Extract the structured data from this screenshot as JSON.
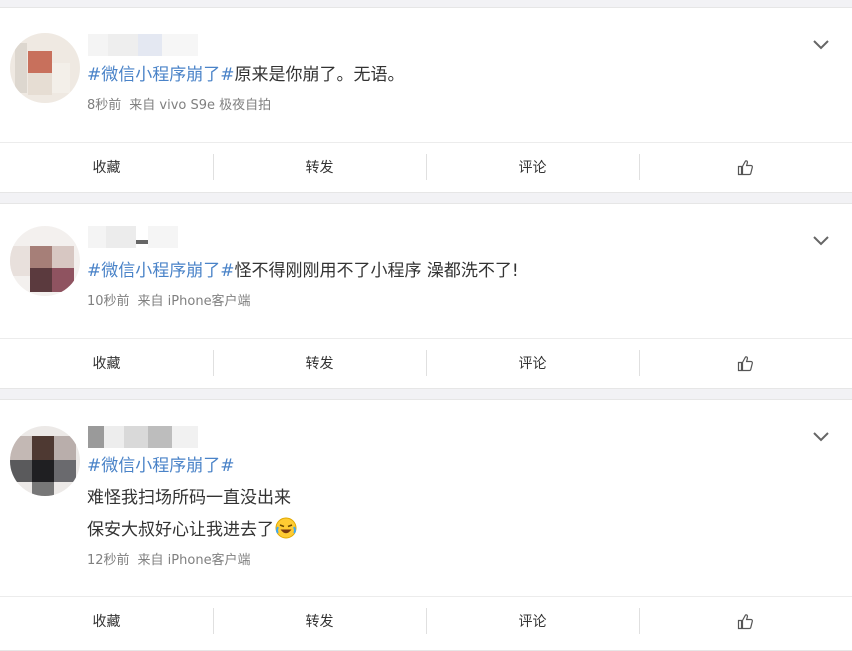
{
  "posts": [
    {
      "topic": "#微信小程序崩了#",
      "lines": [
        "原来是你崩了。无语。"
      ],
      "time": "8秒前",
      "source": "来自 vivo S9e 极夜自拍"
    },
    {
      "topic": "#微信小程序崩了#",
      "lines": [
        "怪不得刚刚用不了小程序 澡都洗不了!"
      ],
      "time": "10秒前",
      "source": "来自 iPhone客户端"
    },
    {
      "topic": "#微信小程序崩了#",
      "lines": [
        "难怪我扫场所码一直没出来",
        "保安大叔好心让我进去了"
      ],
      "emoji": "laughing-crying-emoji",
      "time": "12秒前",
      "source": "来自 iPhone客户端"
    }
  ],
  "actions": {
    "favorite": "收藏",
    "repost": "转发",
    "comment": "评论",
    "like_icon": "thumbs-up-icon"
  },
  "colors": {
    "topic": "#4a83c8",
    "meta": "#808080",
    "background": "#f2f2f5"
  }
}
